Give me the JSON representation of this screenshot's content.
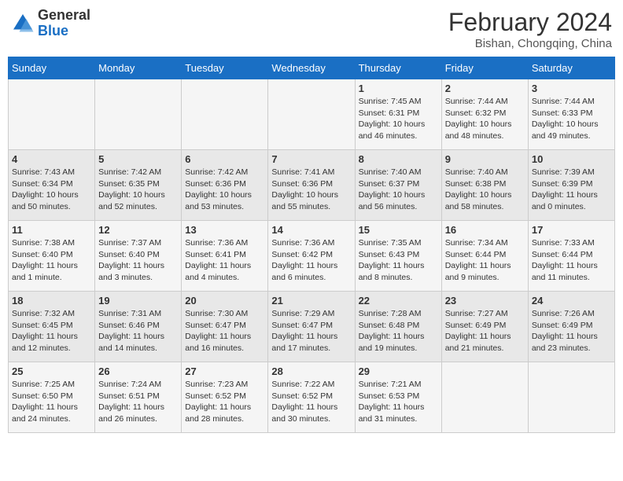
{
  "header": {
    "logo_general": "General",
    "logo_blue": "Blue",
    "main_title": "February 2024",
    "sub_title": "Bishan, Chongqing, China"
  },
  "columns": [
    "Sunday",
    "Monday",
    "Tuesday",
    "Wednesday",
    "Thursday",
    "Friday",
    "Saturday"
  ],
  "weeks": [
    [
      {
        "day": "",
        "info": ""
      },
      {
        "day": "",
        "info": ""
      },
      {
        "day": "",
        "info": ""
      },
      {
        "day": "",
        "info": ""
      },
      {
        "day": "1",
        "info": "Sunrise: 7:45 AM\nSunset: 6:31 PM\nDaylight: 10 hours and 46 minutes."
      },
      {
        "day": "2",
        "info": "Sunrise: 7:44 AM\nSunset: 6:32 PM\nDaylight: 10 hours and 48 minutes."
      },
      {
        "day": "3",
        "info": "Sunrise: 7:44 AM\nSunset: 6:33 PM\nDaylight: 10 hours and 49 minutes."
      }
    ],
    [
      {
        "day": "4",
        "info": "Sunrise: 7:43 AM\nSunset: 6:34 PM\nDaylight: 10 hours and 50 minutes."
      },
      {
        "day": "5",
        "info": "Sunrise: 7:42 AM\nSunset: 6:35 PM\nDaylight: 10 hours and 52 minutes."
      },
      {
        "day": "6",
        "info": "Sunrise: 7:42 AM\nSunset: 6:36 PM\nDaylight: 10 hours and 53 minutes."
      },
      {
        "day": "7",
        "info": "Sunrise: 7:41 AM\nSunset: 6:36 PM\nDaylight: 10 hours and 55 minutes."
      },
      {
        "day": "8",
        "info": "Sunrise: 7:40 AM\nSunset: 6:37 PM\nDaylight: 10 hours and 56 minutes."
      },
      {
        "day": "9",
        "info": "Sunrise: 7:40 AM\nSunset: 6:38 PM\nDaylight: 10 hours and 58 minutes."
      },
      {
        "day": "10",
        "info": "Sunrise: 7:39 AM\nSunset: 6:39 PM\nDaylight: 11 hours and 0 minutes."
      }
    ],
    [
      {
        "day": "11",
        "info": "Sunrise: 7:38 AM\nSunset: 6:40 PM\nDaylight: 11 hours and 1 minute."
      },
      {
        "day": "12",
        "info": "Sunrise: 7:37 AM\nSunset: 6:40 PM\nDaylight: 11 hours and 3 minutes."
      },
      {
        "day": "13",
        "info": "Sunrise: 7:36 AM\nSunset: 6:41 PM\nDaylight: 11 hours and 4 minutes."
      },
      {
        "day": "14",
        "info": "Sunrise: 7:36 AM\nSunset: 6:42 PM\nDaylight: 11 hours and 6 minutes."
      },
      {
        "day": "15",
        "info": "Sunrise: 7:35 AM\nSunset: 6:43 PM\nDaylight: 11 hours and 8 minutes."
      },
      {
        "day": "16",
        "info": "Sunrise: 7:34 AM\nSunset: 6:44 PM\nDaylight: 11 hours and 9 minutes."
      },
      {
        "day": "17",
        "info": "Sunrise: 7:33 AM\nSunset: 6:44 PM\nDaylight: 11 hours and 11 minutes."
      }
    ],
    [
      {
        "day": "18",
        "info": "Sunrise: 7:32 AM\nSunset: 6:45 PM\nDaylight: 11 hours and 12 minutes."
      },
      {
        "day": "19",
        "info": "Sunrise: 7:31 AM\nSunset: 6:46 PM\nDaylight: 11 hours and 14 minutes."
      },
      {
        "day": "20",
        "info": "Sunrise: 7:30 AM\nSunset: 6:47 PM\nDaylight: 11 hours and 16 minutes."
      },
      {
        "day": "21",
        "info": "Sunrise: 7:29 AM\nSunset: 6:47 PM\nDaylight: 11 hours and 17 minutes."
      },
      {
        "day": "22",
        "info": "Sunrise: 7:28 AM\nSunset: 6:48 PM\nDaylight: 11 hours and 19 minutes."
      },
      {
        "day": "23",
        "info": "Sunrise: 7:27 AM\nSunset: 6:49 PM\nDaylight: 11 hours and 21 minutes."
      },
      {
        "day": "24",
        "info": "Sunrise: 7:26 AM\nSunset: 6:49 PM\nDaylight: 11 hours and 23 minutes."
      }
    ],
    [
      {
        "day": "25",
        "info": "Sunrise: 7:25 AM\nSunset: 6:50 PM\nDaylight: 11 hours and 24 minutes."
      },
      {
        "day": "26",
        "info": "Sunrise: 7:24 AM\nSunset: 6:51 PM\nDaylight: 11 hours and 26 minutes."
      },
      {
        "day": "27",
        "info": "Sunrise: 7:23 AM\nSunset: 6:52 PM\nDaylight: 11 hours and 28 minutes."
      },
      {
        "day": "28",
        "info": "Sunrise: 7:22 AM\nSunset: 6:52 PM\nDaylight: 11 hours and 30 minutes."
      },
      {
        "day": "29",
        "info": "Sunrise: 7:21 AM\nSunset: 6:53 PM\nDaylight: 11 hours and 31 minutes."
      },
      {
        "day": "",
        "info": ""
      },
      {
        "day": "",
        "info": ""
      }
    ]
  ]
}
